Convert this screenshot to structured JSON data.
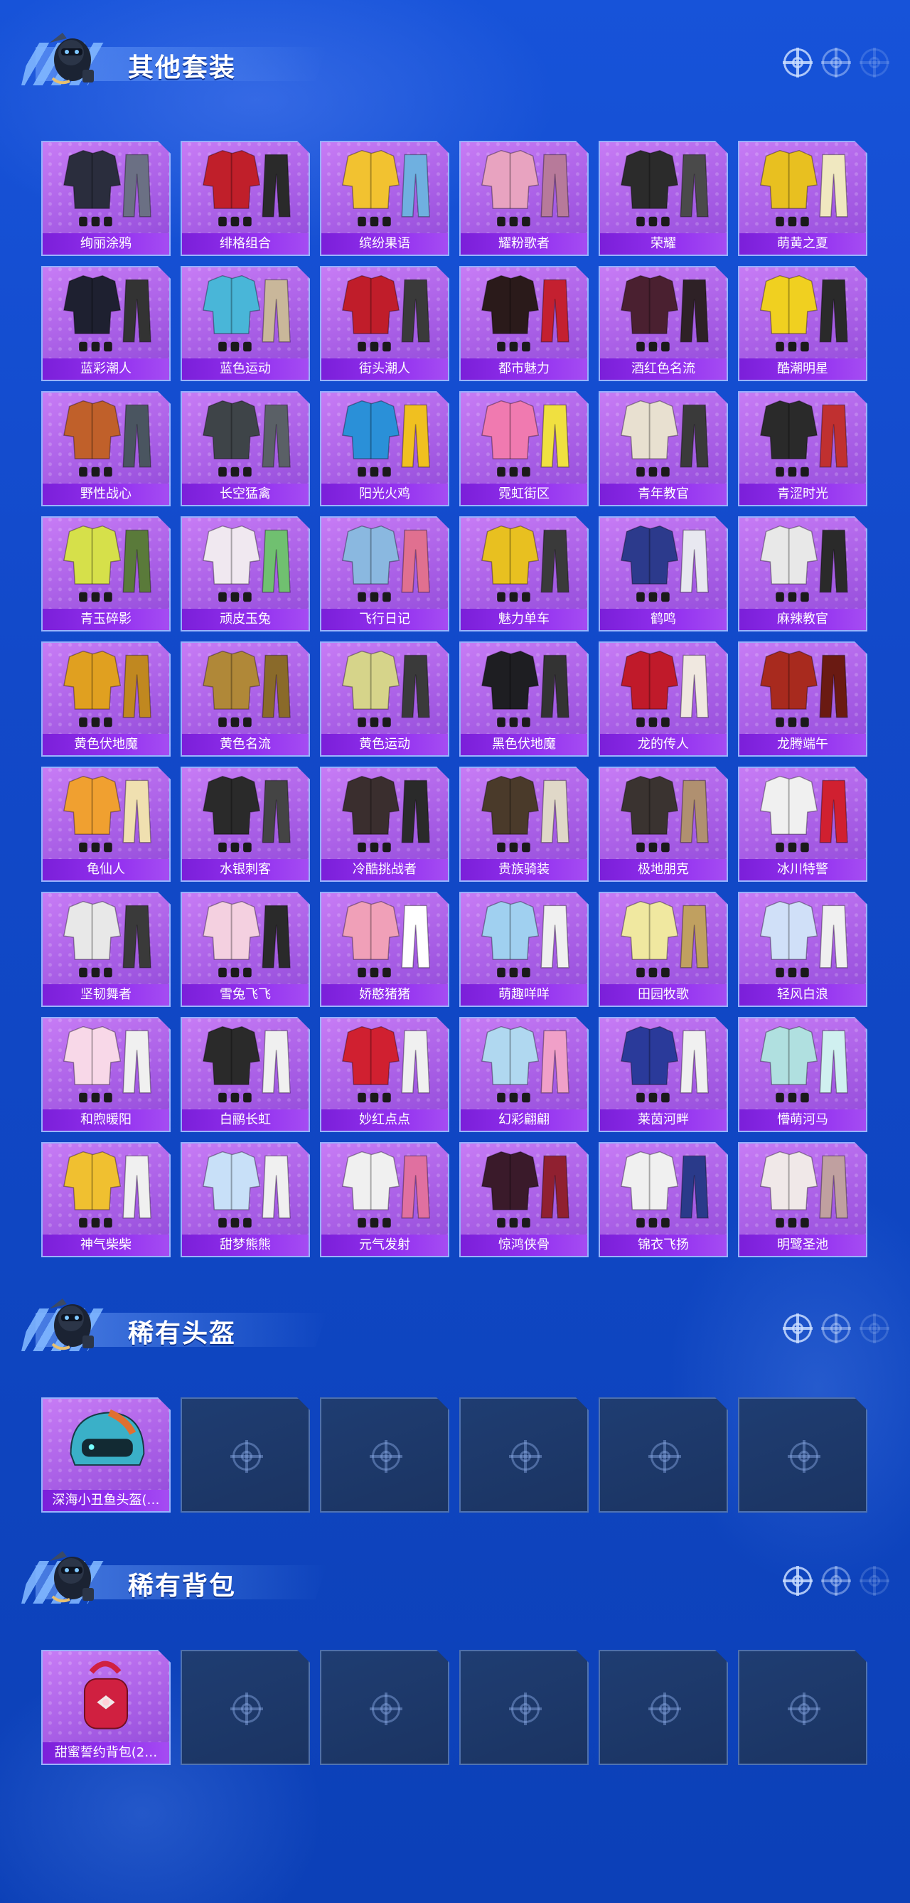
{
  "sections": [
    {
      "title": "其他套装",
      "items": [
        {
          "name": "绚丽涂鸦",
          "c1": "#2a2d3d",
          "c2": "#6b7084"
        },
        {
          "name": "绯格组合",
          "c1": "#c01f2a",
          "c2": "#2a2a2a"
        },
        {
          "name": "缤纷果语",
          "c1": "#f2c230",
          "c2": "#6fb0e0"
        },
        {
          "name": "耀粉歌者",
          "c1": "#e8a3c0",
          "c2": "#b77a9a"
        },
        {
          "name": "荣耀",
          "c1": "#2b2b2b",
          "c2": "#4a4a4a"
        },
        {
          "name": "萌黄之夏",
          "c1": "#e8c020",
          "c2": "#f0e8c0"
        },
        {
          "name": "蓝彩潮人",
          "c1": "#1e2030",
          "c2": "#333"
        },
        {
          "name": "蓝色运动",
          "c1": "#49b6d8",
          "c2": "#c9b79a"
        },
        {
          "name": "街头潮人",
          "c1": "#c01d2a",
          "c2": "#3a3a3a"
        },
        {
          "name": "都市魅力",
          "c1": "#2a1a1a",
          "c2": "#c42030"
        },
        {
          "name": "酒红色名流",
          "c1": "#4a2030",
          "c2": "#2e2126"
        },
        {
          "name": "酷潮明星",
          "c1": "#f0d020",
          "c2": "#2a2a2a"
        },
        {
          "name": "野性战心",
          "c1": "#c0602a",
          "c2": "#4a5560"
        },
        {
          "name": "长空猛禽",
          "c1": "#3e4448",
          "c2": "#5a6066"
        },
        {
          "name": "阳光火鸡",
          "c1": "#2a90d8",
          "c2": "#f0c020"
        },
        {
          "name": "霓虹街区",
          "c1": "#f07ab0",
          "c2": "#f0e040"
        },
        {
          "name": "青年教官",
          "c1": "#e8e0d0",
          "c2": "#3a3a3a"
        },
        {
          "name": "青涩时光",
          "c1": "#2a2a2a",
          "c2": "#c03030"
        },
        {
          "name": "青玉碎影",
          "c1": "#d6e04a",
          "c2": "#5a7a3a"
        },
        {
          "name": "顽皮玉兔",
          "c1": "#f0e8f0",
          "c2": "#70c070"
        },
        {
          "name": "飞行日记",
          "c1": "#8ab8e0",
          "c2": "#e07090"
        },
        {
          "name": "魅力单车",
          "c1": "#e8c020",
          "c2": "#3a3a3a"
        },
        {
          "name": "鹤鸣",
          "c1": "#2c3a8c",
          "c2": "#e8e8f0"
        },
        {
          "name": "麻辣教官",
          "c1": "#e8e8e8",
          "c2": "#2a2a2a"
        },
        {
          "name": "黄色伏地魔",
          "c1": "#e0a020",
          "c2": "#c08820"
        },
        {
          "name": "黄色名流",
          "c1": "#b08838",
          "c2": "#8a6a2a"
        },
        {
          "name": "黄色运动",
          "c1": "#d6d48a",
          "c2": "#3a3a3a"
        },
        {
          "name": "黑色伏地魔",
          "c1": "#1e1e22",
          "c2": "#333"
        },
        {
          "name": "龙的传人",
          "c1": "#c01a2a",
          "c2": "#f0e8e0"
        },
        {
          "name": "龙腾端午",
          "c1": "#a82a1e",
          "c2": "#6a1a12"
        },
        {
          "name": "龟仙人",
          "c1": "#f0a030",
          "c2": "#f0e0b0"
        },
        {
          "name": "水银刺客",
          "c1": "#2a2a2a",
          "c2": "#444"
        },
        {
          "name": "冷酷挑战者",
          "c1": "#3a2e2e",
          "c2": "#2a2a2a"
        },
        {
          "name": "贵族骑装",
          "c1": "#4a3a2a",
          "c2": "#e0d8c8"
        },
        {
          "name": "极地朋克",
          "c1": "#3a3330",
          "c2": "#b09070"
        },
        {
          "name": "冰川特警",
          "c1": "#f0f0f0",
          "c2": "#d02030"
        },
        {
          "name": "坚韧舞者",
          "c1": "#e8e8e8",
          "c2": "#3a3a3a"
        },
        {
          "name": "雪兔飞飞",
          "c1": "#f4d0e0",
          "c2": "#2a2a2a"
        },
        {
          "name": "娇憨猪猪",
          "c1": "#f0a0b8",
          "c2": "#ffffff"
        },
        {
          "name": "萌趣咩咩",
          "c1": "#a0d0f0",
          "c2": "#f0f0f0"
        },
        {
          "name": "田园牧歌",
          "c1": "#f0e8a0",
          "c2": "#c0a060"
        },
        {
          "name": "轻风白浪",
          "c1": "#d0e0f8",
          "c2": "#f0f0f0"
        },
        {
          "name": "和煦暖阳",
          "c1": "#f8d8e8",
          "c2": "#f0f0f0"
        },
        {
          "name": "白鹂长虹",
          "c1": "#2a2a2a",
          "c2": "#f0f0f0"
        },
        {
          "name": "妙红点点",
          "c1": "#d02030",
          "c2": "#f0f0f0"
        },
        {
          "name": "幻彩翩翩",
          "c1": "#b0d8f0",
          "c2": "#f0a0c8"
        },
        {
          "name": "莱茵河畔",
          "c1": "#2a3a9a",
          "c2": "#f0f0f0"
        },
        {
          "name": "懵萌河马",
          "c1": "#b0e0e0",
          "c2": "#d0f0f0"
        },
        {
          "name": "神气柴柴",
          "c1": "#f0c030",
          "c2": "#f0f0f0"
        },
        {
          "name": "甜梦熊熊",
          "c1": "#c8e0f8",
          "c2": "#f0f0f0"
        },
        {
          "name": "元气发射",
          "c1": "#f0f0f0",
          "c2": "#e070a0"
        },
        {
          "name": "惊鸿侠骨",
          "c1": "#3a1a2a",
          "c2": "#902030"
        },
        {
          "name": "锦衣飞扬",
          "c1": "#f0f0f0",
          "c2": "#2a3a8a"
        },
        {
          "name": "明鹭圣池",
          "c1": "#f0e8e8",
          "c2": "#c0a0a0"
        }
      ]
    },
    {
      "title": "稀有头盔",
      "items": [
        {
          "name": "深海小丑鱼头盔(…",
          "c1": "#3ab0c8",
          "c2": "#e07030"
        }
      ],
      "empty_slots": 5
    },
    {
      "title": "稀有背包",
      "items": [
        {
          "name": "甜蜜誓约背包(2…",
          "c1": "#d02040",
          "c2": "#f0e8e8"
        }
      ],
      "empty_slots": 5
    }
  ],
  "theme": {
    "accent": "#9432f0",
    "background": "#1249c9",
    "card_border": "#96b9ff"
  }
}
